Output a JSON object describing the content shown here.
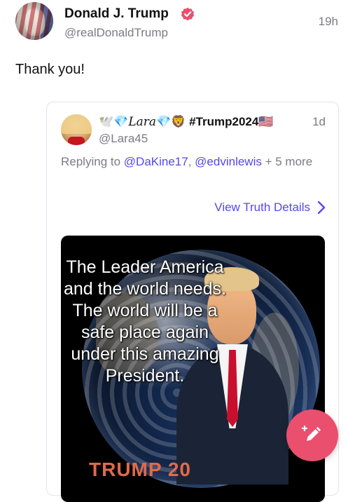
{
  "post": {
    "author_name": "Donald J. Trump",
    "author_handle": "@realDonaldTrump",
    "timestamp": "19h",
    "text": "Thank you!",
    "verified_icon": "verified-badge-icon"
  },
  "quote": {
    "name_prefix": "🕊️💎",
    "name_script": "Lara",
    "name_suffix": "💎🦁 #Trump2024🇺🇸",
    "handle": "@Lara45",
    "timestamp": "1d",
    "replying_prefix": "Replying to ",
    "mention_1": "@DaKine17",
    "mention_sep": ", ",
    "mention_2": "@edvinlewis",
    "replying_suffix": " + 5 more",
    "view_details_label": "View Truth Details",
    "media_text": "The Leader America and the world needs. The world will be a safe place again under this amazing President.",
    "media_brand_text": "TRUMP 20"
  },
  "compose_button": {
    "icon": "compose-pen-icon"
  },
  "colors": {
    "accent": "#5448ee",
    "fab": "#ea4f6e",
    "muted_text": "#7b7b86",
    "verified": "#ea4f6e"
  }
}
